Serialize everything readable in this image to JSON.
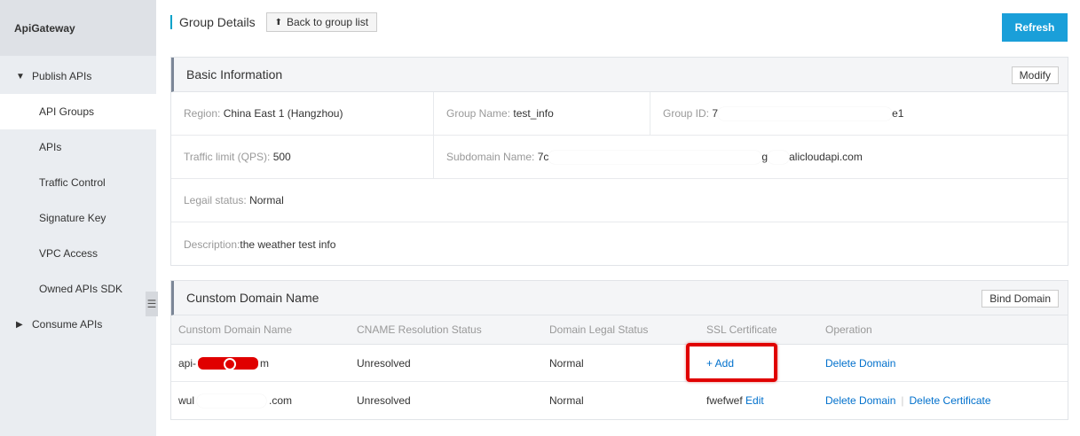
{
  "sidebar": {
    "title": "ApiGateway",
    "publish_group": "Publish APIs",
    "items": [
      {
        "label": "API Groups"
      },
      {
        "label": "APIs"
      },
      {
        "label": "Traffic Control"
      },
      {
        "label": "Signature Key"
      },
      {
        "label": "VPC Access"
      },
      {
        "label": "Owned APIs SDK"
      }
    ],
    "consume_group": "Consume APIs",
    "collapse_icon": "☰"
  },
  "header": {
    "title": "Group Details",
    "back_label": "Back to group list",
    "refresh_label": "Refresh"
  },
  "basic": {
    "title": "Basic Information",
    "modify_label": "Modify",
    "region_label": "Region:",
    "region_value": "China East 1 (Hangzhou)",
    "group_name_label": "Group Name:",
    "group_name_value": "test_info",
    "group_id_label": "Group ID:",
    "group_id_prefix": "7",
    "group_id_suffix": "e1",
    "traffic_label": "Traffic limit (QPS):",
    "traffic_value": "500",
    "subdomain_label": "Subdomain Name:",
    "subdomain_prefix": "7c",
    "subdomain_mid": "g",
    "subdomain_suffix": "alicloudapi.com",
    "legal_label": "Legail status:",
    "legal_value": "Normal",
    "desc_label": "Description:",
    "desc_value": "the weather test info"
  },
  "domains": {
    "title": "Cunstom Domain Name",
    "bind_label": "Bind Domain",
    "columns": [
      "Cunstom Domain Name",
      "CNAME Resolution Status",
      "Domain Legal Status",
      "SSL Certificate",
      "Operation"
    ],
    "rows": [
      {
        "domain_prefix": "api-",
        "domain_suffix": "m",
        "cname": "Unresolved",
        "legal": "Normal",
        "ssl_add": "+ Add",
        "op_delete_domain": "Delete Domain"
      },
      {
        "domain_prefix": "wul",
        "domain_suffix": ".com",
        "cname": "Unresolved",
        "legal": "Normal",
        "ssl_name": "fwefwef",
        "ssl_edit": "Edit",
        "op_delete_domain": "Delete Domain",
        "op_delete_cert": "Delete Certificate"
      }
    ]
  },
  "colors": {
    "accent": "#1a9fd9",
    "link": "#0070cc",
    "highlight": "#e00000"
  }
}
